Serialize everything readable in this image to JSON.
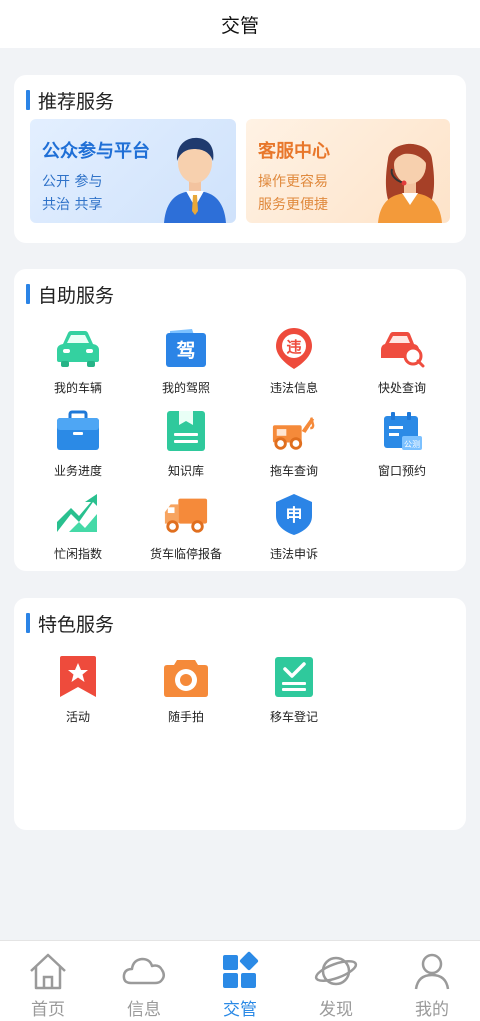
{
  "header": {
    "title": "交管"
  },
  "recommend": {
    "title": "推荐服务",
    "cards": [
      {
        "title": "公众参与平台",
        "line1": "公开  参与",
        "line2": "共治  共享"
      },
      {
        "title": "客服中心",
        "line1": "操作更容易",
        "line2": "服务更便捷"
      }
    ]
  },
  "self_service": {
    "title": "自助服务",
    "items": [
      {
        "label": "我的车辆",
        "icon": "car-icon"
      },
      {
        "label": "我的驾照",
        "icon": "license-icon"
      },
      {
        "label": "违法信息",
        "icon": "violation-icon"
      },
      {
        "label": "快处查询",
        "icon": "quick-handle-icon"
      },
      {
        "label": "业务进度",
        "icon": "briefcase-icon"
      },
      {
        "label": "知识库",
        "icon": "knowledge-book-icon"
      },
      {
        "label": "拖车查询",
        "icon": "tow-truck-icon"
      },
      {
        "label": "窗口预约",
        "icon": "calendar-icon"
      },
      {
        "label": "忙闲指数",
        "icon": "trend-icon"
      },
      {
        "label": "货车临停报备",
        "icon": "truck-icon"
      },
      {
        "label": "违法申诉",
        "icon": "appeal-icon"
      }
    ]
  },
  "featured": {
    "title": "特色服务",
    "items": [
      {
        "label": "活动",
        "icon": "star-bookmark-icon"
      },
      {
        "label": "随手拍",
        "icon": "camera-icon"
      },
      {
        "label": "移车登记",
        "icon": "checklist-icon"
      }
    ]
  },
  "tabbar": {
    "tabs": [
      {
        "label": "首页",
        "icon": "home-icon"
      },
      {
        "label": "信息",
        "icon": "cloud-icon"
      },
      {
        "label": "交管",
        "icon": "grid-icon",
        "active": true
      },
      {
        "label": "发现",
        "icon": "planet-icon"
      },
      {
        "label": "我的",
        "icon": "person-icon"
      }
    ]
  },
  "colors": {
    "accent": "#2b8ae6",
    "background": "#f1f3f6"
  }
}
